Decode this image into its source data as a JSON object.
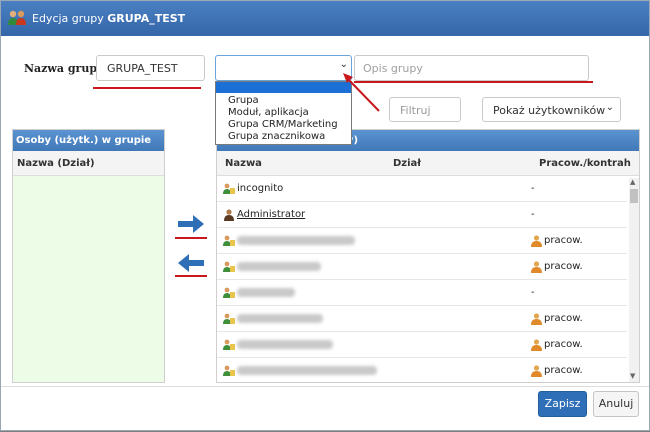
{
  "dialog": {
    "title_prefix": "Edycja grupy ",
    "title_group": "GRUPA_TEST"
  },
  "form": {
    "name_label": "Nazwa grupy:",
    "name_value": "GRUPA_TEST",
    "group_type_value": "",
    "description_placeholder": "Opis grupy",
    "group_type_options": [
      "",
      "Grupa",
      "Moduł, aplikacja",
      "Grupa CRM/Marketing",
      "Grupa znacznikowa"
    ]
  },
  "toolbar": {
    "filter_placeholder": "Filtruj",
    "show_select_value": "Pokaż użytkowników"
  },
  "left_panel": {
    "header": "Osoby (użytk.) w grupie",
    "column_name": "Nazwa (Dział)"
  },
  "right_panel": {
    "header": "cy)",
    "columns": {
      "name": "Nazwa",
      "department": "Dział",
      "employment": "Pracow./kontrah"
    },
    "rows": [
      {
        "name": "incognito",
        "type": "-"
      },
      {
        "name": "Administrator",
        "type": "-"
      },
      {
        "name": "",
        "type": "pracow."
      },
      {
        "name": "",
        "type": "pracow."
      },
      {
        "name": "",
        "type": "-"
      },
      {
        "name": "",
        "type": "pracow."
      },
      {
        "name": "",
        "type": "pracow."
      },
      {
        "name": "",
        "type": "pracow."
      }
    ]
  },
  "buttons": {
    "save": "Zapisz",
    "cancel": "Anuluj"
  },
  "colors": {
    "title_bar": "#3a6fb0",
    "panel_header": "#4c87c6",
    "annotation_red": "#c8181e",
    "arrow_blue": "#2e6fb8",
    "left_list_bg": "#ecfce6"
  }
}
